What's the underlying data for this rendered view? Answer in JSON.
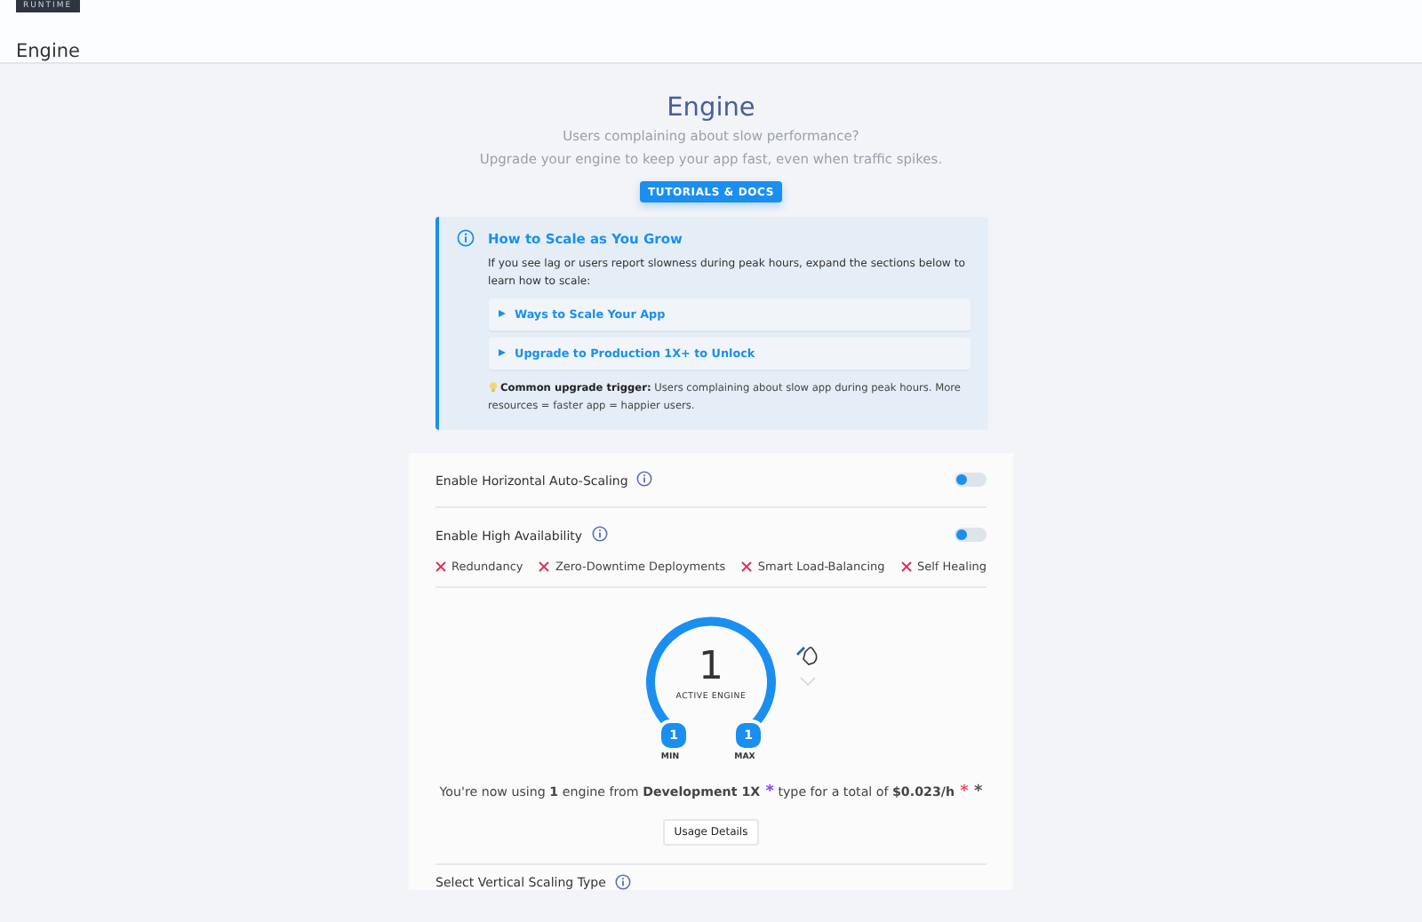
{
  "header": {
    "badge": "RUNTIME",
    "title": "Engine"
  },
  "intro": {
    "title": "Engine",
    "subtitle_lines": [
      "Users complaining about slow performance?",
      "Upgrade your engine to keep your app fast, even when traffic spikes."
    ],
    "button": "TUTORIALS & DOCS"
  },
  "info_box": {
    "title": "How to Scale as You Grow",
    "text": "If you see lag or users report slowness during peak hours, expand the sections below to learn how to scale:",
    "sections": [
      {
        "label": "Ways to Scale Your App",
        "expanded": false
      },
      {
        "label": "Upgrade to Production 1X+ to Unlock",
        "expanded": false
      }
    ],
    "tip": "**Common upgrade trigger:** Users complaining about slow app during peak hours. More resources = faster app = happier users."
  },
  "settings": [
    {
      "label": "Enable Horizontal Auto-Scaling",
      "on": false
    },
    {
      "label": "Enable High Availability",
      "on": false
    }
  ],
  "features": [
    {
      "label": "Redundancy",
      "available": false
    },
    {
      "label": "Zero-Downtime Deployments",
      "available": false
    },
    {
      "label": "Smart Load-Balancing",
      "available": false
    },
    {
      "label": "Self Healing",
      "available": false
    }
  ],
  "dial": {
    "value": "1",
    "caption": "ACTIVE ENGINE",
    "min": "1",
    "min_label": "MIN",
    "max": "1",
    "max_label": "MAX"
  },
  "summary": [
    {
      "kind": "text",
      "text": "You're now using "
    },
    {
      "kind": "bold",
      "text": "1"
    },
    {
      "kind": "text",
      "text": " engine from "
    },
    {
      "kind": "bold",
      "text": "Development 1X"
    },
    {
      "kind": "mark",
      "text": " *",
      "color": "#8a3ffc"
    },
    {
      "kind": "text",
      "text": " type for a total of "
    },
    {
      "kind": "bold",
      "text": "$0.023/h"
    },
    {
      "kind": "mark",
      "text": " *",
      "color": "#f0506e"
    },
    {
      "kind": "mark",
      "text": " *",
      "color": "#555555"
    }
  ],
  "usage_button": "Usage Details",
  "vertical_label": "Select Vertical Scaling Type"
}
